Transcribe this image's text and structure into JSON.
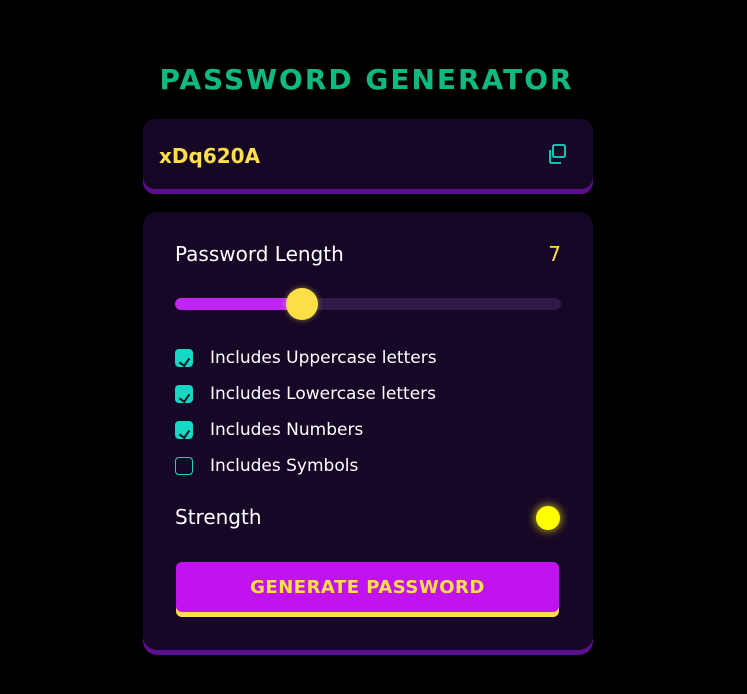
{
  "title": "PASSWORD GENERATOR",
  "password": {
    "value": "xDq620A",
    "copy_icon": "copy-icon"
  },
  "length": {
    "label": "Password Length",
    "value": "7",
    "slider_fraction": 0.33
  },
  "options": [
    {
      "label": "Includes Uppercase letters",
      "checked": true
    },
    {
      "label": "Includes Lowercase letters",
      "checked": true
    },
    {
      "label": "Includes Numbers",
      "checked": true
    },
    {
      "label": "Includes Symbols",
      "checked": false
    }
  ],
  "strength": {
    "label": "Strength",
    "indicator_color": "#ffff00"
  },
  "generate_button": {
    "label": "GENERATE PASSWORD"
  },
  "colors": {
    "accent_title": "#10b981",
    "accent_yellow": "#fde047",
    "accent_purple": "#c013f0",
    "checkbox_teal": "#14d8c4",
    "panel_bg": "#170726"
  }
}
